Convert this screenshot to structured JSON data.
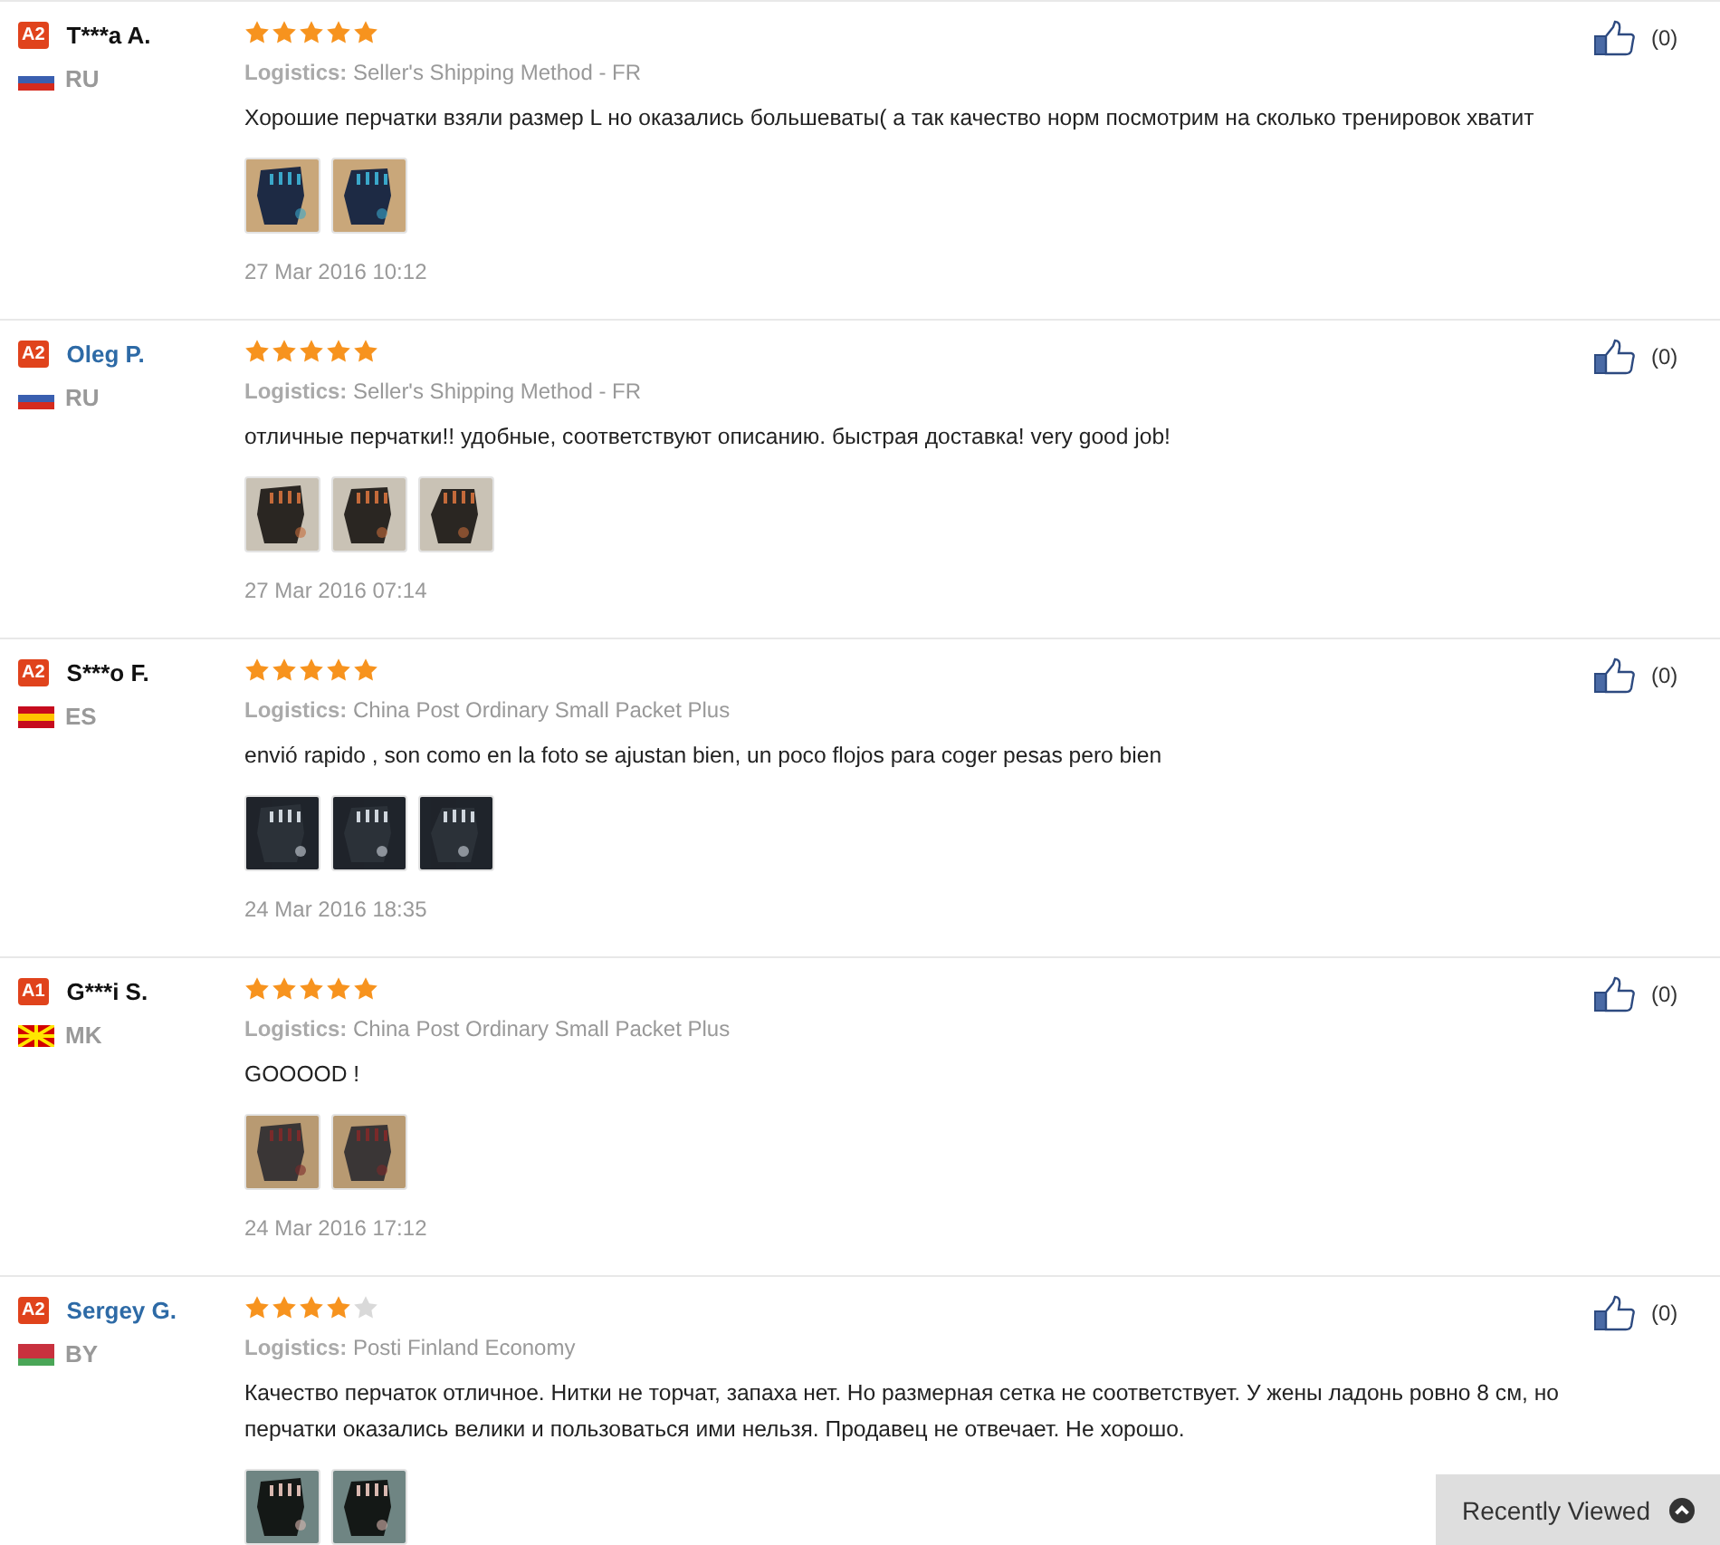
{
  "reviews": [
    {
      "level_badge": "A2",
      "name": "T***a A.",
      "linked": false,
      "country": "RU",
      "flag": {
        "kind": "russia"
      },
      "stars": 5,
      "logistics_label": "Logistics:",
      "logistics": "Seller's Shipping Method - FR",
      "text": "Хорошие перчатки взяли размер L но оказались большеваты( а так качество норм посмотрим на сколько тренировок хватит",
      "photos": [
        {
          "kind": "picture"
        },
        {
          "kind": "picture"
        }
      ],
      "date": "27 Mar 2016 10:12",
      "likes": "(0)"
    },
    {
      "level_badge": "A2",
      "name": "Oleg P.",
      "linked": true,
      "country": "RU",
      "flag": {
        "kind": "russia"
      },
      "stars": 5,
      "logistics_label": "Logistics:",
      "logistics": "Seller's Shipping Method - FR",
      "text": "отличные перчатки!! удобные, соответствуют описанию. быстрая доставка! very good job!",
      "photos": [
        {
          "kind": "picture"
        },
        {
          "kind": "picture"
        },
        {
          "kind": "picture"
        }
      ],
      "date": "27 Mar 2016 07:14",
      "likes": "(0)"
    },
    {
      "level_badge": "A2",
      "name": "S***o F.",
      "linked": false,
      "country": "ES",
      "flag": {
        "kind": "spain"
      },
      "stars": 5,
      "logistics_label": "Logistics:",
      "logistics": "China Post Ordinary Small Packet Plus",
      "text": "envió rapido , son como en la foto se ajustan bien, un poco flojos para coger pesas pero bien",
      "photos": [
        {
          "kind": "picture"
        },
        {
          "kind": "picture"
        },
        {
          "kind": "picture"
        }
      ],
      "date": "24 Mar 2016 18:35",
      "likes": "(0)"
    },
    {
      "level_badge": "A1",
      "name": "G***i S.",
      "linked": false,
      "country": "MK",
      "flag": {
        "kind": "macedonia"
      },
      "stars": 5,
      "logistics_label": "Logistics:",
      "logistics": "China Post Ordinary Small Packet Plus",
      "text": "GOOOOD !",
      "photos": [
        {
          "kind": "picture"
        },
        {
          "kind": "picture"
        }
      ],
      "date": "24 Mar 2016 17:12",
      "likes": "(0)"
    },
    {
      "level_badge": "A2",
      "name": "Sergey G.",
      "linked": true,
      "country": "BY",
      "flag": {
        "kind": "belarus"
      },
      "stars": 4,
      "logistics_label": "Logistics:",
      "logistics": "Posti Finland Economy",
      "text": "Качество перчаток отличное. Нитки не торчат, запаха нет. Но размерная сетка не соответствует. У жены ладонь ровно 8 см, но перчатки оказались велики и пользоваться ими нельзя. Продавец не отвечает. Не хорошо.",
      "photos": [
        {
          "kind": "picture"
        },
        {
          "kind": "picture"
        }
      ],
      "likes": "(0)"
    }
  ],
  "recently_viewed": {
    "label": "Recently Viewed"
  }
}
